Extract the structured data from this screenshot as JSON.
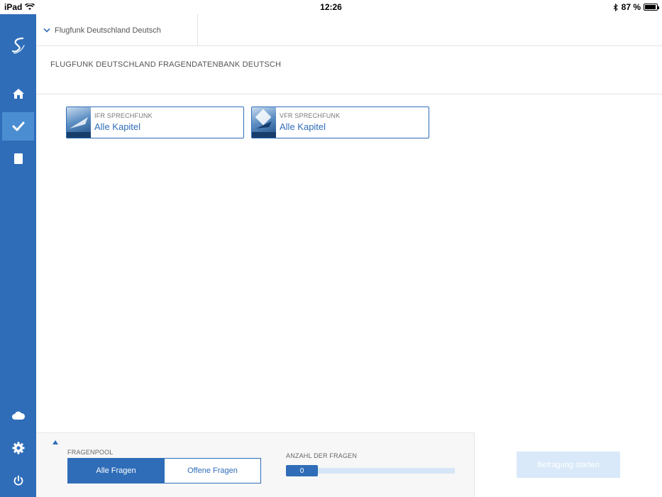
{
  "statusbar": {
    "device": "iPad",
    "time": "12:26",
    "battery_text": "87 %",
    "battery_level": 0.87
  },
  "sidebar": {
    "items": [
      {
        "name": "logo",
        "icon": "logo-icon"
      },
      {
        "name": "home",
        "icon": "home-icon"
      },
      {
        "name": "check",
        "icon": "check-icon",
        "active": true
      },
      {
        "name": "document",
        "icon": "document-icon"
      },
      {
        "name": "cloud",
        "icon": "cloud-icon"
      },
      {
        "name": "settings",
        "icon": "gear-icon"
      },
      {
        "name": "power",
        "icon": "power-icon"
      }
    ]
  },
  "topbar": {
    "dropdown_label": "Flugfunk Deutschland Deutsch"
  },
  "page": {
    "title": "FLUGFUNK DEUTSCHLAND FRAGENDATENBANK DEUTSCH"
  },
  "cards": [
    {
      "category": "IFR SPRECHFUNK",
      "chapter": "Alle Kapitel"
    },
    {
      "category": "VFR SPRECHFUNK",
      "chapter": "Alle Kapitel"
    }
  ],
  "bottom": {
    "pool_label": "FRAGENPOOL",
    "pool_options": [
      "Alle Fragen",
      "Offene Fragen"
    ],
    "pool_selected": "Alle Fragen",
    "count_label": "ANZAHL DER FRAGEN",
    "count_value": "0",
    "start_label": "Befragung starten"
  },
  "colors": {
    "accent": "#2f6db8",
    "sidebar_active": "#4a8ed1",
    "button_disabled": "#d9e9f9"
  }
}
